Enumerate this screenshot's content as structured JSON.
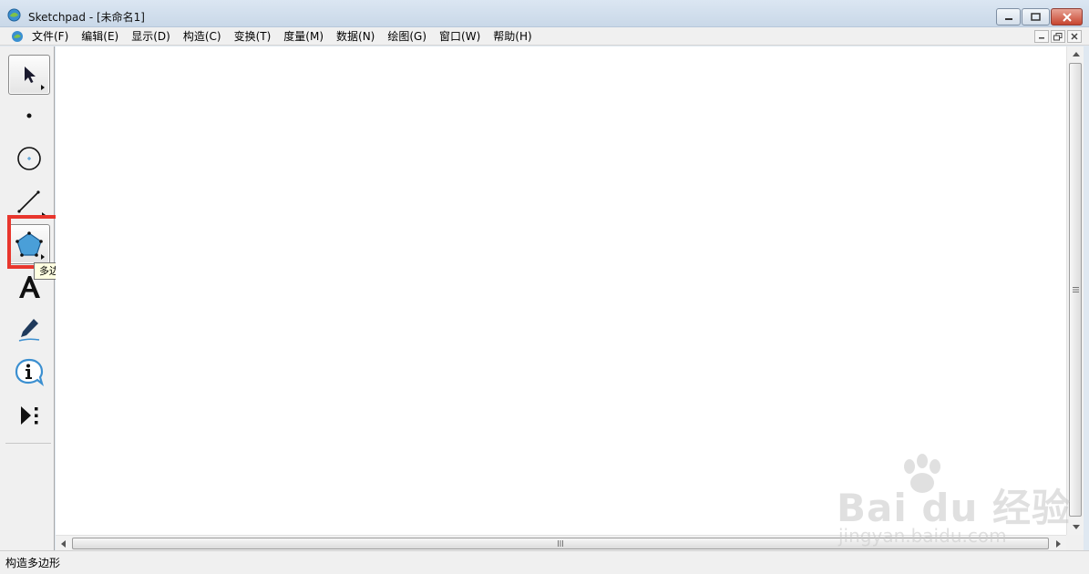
{
  "window": {
    "title": "Sketchpad  - [未命名1]"
  },
  "menu": {
    "items": [
      {
        "label": "文件(F)"
      },
      {
        "label": "编辑(E)"
      },
      {
        "label": "显示(D)"
      },
      {
        "label": "构造(C)"
      },
      {
        "label": "变换(T)"
      },
      {
        "label": "度量(M)"
      },
      {
        "label": "数据(N)"
      },
      {
        "label": "绘图(G)"
      },
      {
        "label": "窗口(W)"
      },
      {
        "label": "帮助(H)"
      }
    ]
  },
  "toolbox": {
    "tools": [
      {
        "name": "selection-arrow-tool",
        "icon": "arrow-pointer-icon",
        "active": true
      },
      {
        "name": "point-tool",
        "icon": "dot-icon"
      },
      {
        "name": "compass-tool",
        "icon": "circle-icon"
      },
      {
        "name": "straightedge-tool",
        "icon": "line-segment-icon"
      },
      {
        "name": "polygon-tool",
        "icon": "pentagon-icon"
      },
      {
        "name": "text-tool",
        "icon": "letter-a-icon"
      },
      {
        "name": "marker-tool",
        "icon": "pen-icon"
      },
      {
        "name": "information-tool",
        "icon": "info-icon"
      },
      {
        "name": "custom-tools",
        "icon": "play-dots-icon"
      }
    ],
    "tooltip": "多边形工具"
  },
  "status": {
    "text": "构造多边形"
  },
  "watermark": {
    "main": "Bai du 经验",
    "sub": "jingyan.baidu.com"
  },
  "colors": {
    "highlight": "#e8362d",
    "polygon_fill": "#4a9fd8",
    "marker_line": "#3b8fd0"
  }
}
